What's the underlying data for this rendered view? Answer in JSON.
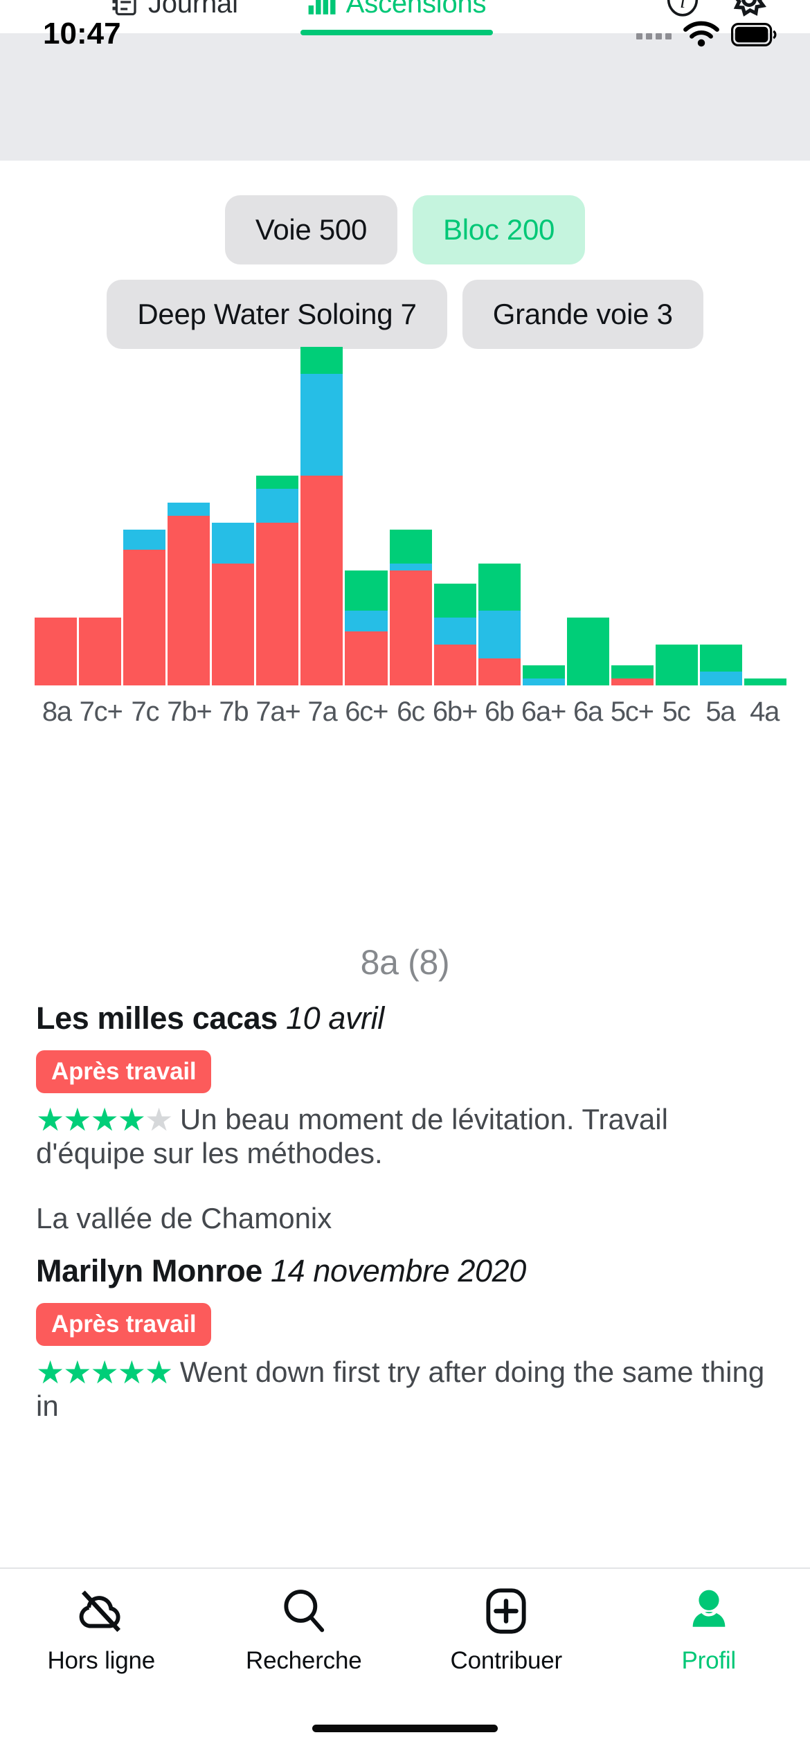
{
  "status_bar": {
    "time": "10:47",
    "wifi_icon": "wifi-icon",
    "battery_icon": "battery-icon",
    "cellular_icon": "cellular-dots-icon"
  },
  "top_tabs": {
    "items": [
      {
        "label": "Journal",
        "icon": "journal-icon",
        "active": false
      },
      {
        "label": "Ascensions",
        "icon": "bar-chart-icon",
        "active": true
      }
    ],
    "actions": [
      {
        "name": "info-icon",
        "label": "i"
      },
      {
        "name": "gear-icon",
        "label": ""
      }
    ]
  },
  "header": {
    "title": "Ascensions"
  },
  "filters": {
    "chips": [
      {
        "label": "Voie 500",
        "selected": false
      },
      {
        "label": "Bloc 200",
        "selected": true
      },
      {
        "label": "Deep Water Soloing 7",
        "selected": false
      },
      {
        "label": "Grande voie 3",
        "selected": false
      }
    ]
  },
  "chart_data": {
    "type": "bar",
    "title": "",
    "xlabel": "",
    "ylabel": "",
    "stacked": true,
    "grid": false,
    "legend_position": "none",
    "ylim": [
      0,
      46
    ],
    "categories": [
      "8a",
      "7c+",
      "7c",
      "7b+",
      "7b",
      "7a+",
      "7a",
      "6c+",
      "6c",
      "6b+",
      "6b",
      "6a+",
      "6a",
      "5c+",
      "5c",
      "5a",
      "4a"
    ],
    "series": [
      {
        "name": "rouge",
        "color": "#fc5858",
        "values": [
          10,
          10,
          20,
          25,
          18,
          24,
          31,
          8,
          17,
          6,
          4,
          0,
          0,
          1,
          0,
          0,
          0
        ]
      },
      {
        "name": "bleu",
        "color": "#26bee6",
        "values": [
          0,
          0,
          3,
          2,
          6,
          5,
          15,
          3,
          1,
          4,
          7,
          1,
          0,
          0,
          0,
          2,
          0
        ]
      },
      {
        "name": "vert",
        "color": "#00ce78",
        "values": [
          0,
          0,
          0,
          0,
          0,
          2,
          4,
          6,
          5,
          5,
          7,
          2,
          10,
          2,
          6,
          4,
          1
        ]
      }
    ]
  },
  "ascent_section": {
    "grade_header": "8a (8)",
    "entries": [
      {
        "name": "Les milles cacas",
        "date": "10 avril",
        "badge": "Après travail",
        "stars_filled": 4,
        "stars_total": 5,
        "review": "Un beau moment de lévitation. Travail d'équipe sur les méthodes."
      }
    ],
    "crag": "La vallée de Chamonix",
    "entries2": [
      {
        "name": "Marilyn Monroe",
        "date": "14 novembre 2020",
        "badge": "Après travail",
        "stars_filled": 5,
        "stars_total": 5,
        "review": "Went down first try after doing the same thing in"
      }
    ]
  },
  "bottom_tabs": {
    "items": [
      {
        "label": "Hors ligne",
        "icon": "cloud-off-icon",
        "active": false
      },
      {
        "label": "Recherche",
        "icon": "search-icon",
        "active": false
      },
      {
        "label": "Contribuer",
        "icon": "plus-box-icon",
        "active": false
      },
      {
        "label": "Profil",
        "icon": "person-icon",
        "active": true
      }
    ]
  },
  "colors": {
    "accent_green": "#00c776",
    "bar_green": "#00ce78",
    "bar_blue": "#26bee6",
    "bar_red": "#fc5858",
    "badge_red": "#fc5b5b",
    "chip_bg": "#e2e2e4",
    "chip_sel_bg": "#c5f4de",
    "nav_bg": "#e9eaed"
  }
}
